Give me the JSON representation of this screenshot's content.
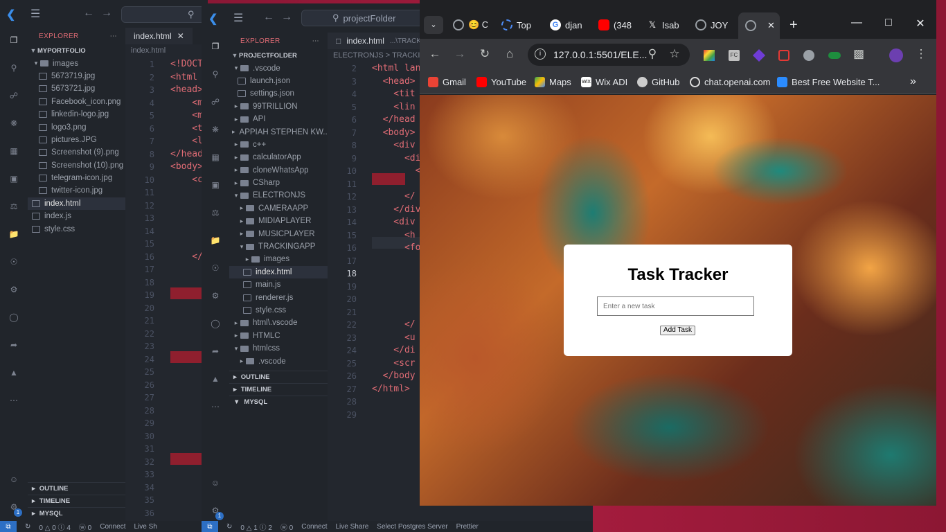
{
  "vscode_back": {
    "explorer_title": "EXPLORER",
    "folder_name": "MYPORTFOLIO",
    "items": [
      {
        "label": "images",
        "type": "folder-open"
      },
      {
        "label": "5673719.jpg",
        "type": "file"
      },
      {
        "label": "5673721.jpg",
        "type": "file"
      },
      {
        "label": "Facebook_icon.png",
        "type": "file"
      },
      {
        "label": "linkedin-logo.jpg",
        "type": "file"
      },
      {
        "label": "logo3.png",
        "type": "file"
      },
      {
        "label": "pictures.JPG",
        "type": "file"
      },
      {
        "label": "Screenshot (9).png",
        "type": "file"
      },
      {
        "label": "Screenshot (10).png",
        "type": "file"
      },
      {
        "label": "telegram-icon.jpg",
        "type": "file"
      },
      {
        "label": "twitter-icon.jpg",
        "type": "file"
      },
      {
        "label": "index.html",
        "type": "file",
        "selected": true
      },
      {
        "label": "index.js",
        "type": "file"
      },
      {
        "label": "style.css",
        "type": "file"
      }
    ],
    "sections": [
      "OUTLINE",
      "TIMELINE",
      "MYSQL"
    ],
    "tab_label": "index.html",
    "breadcrumb": "index.html",
    "line_numbers": [
      "1",
      "2",
      "3",
      "4",
      "5",
      "6",
      "7",
      "8",
      "9",
      "10",
      "11",
      "12",
      "13",
      "14",
      "15",
      "16",
      "17",
      "18",
      "19",
      "20",
      "21",
      "22",
      "23",
      "24",
      "25",
      "26",
      "27",
      "28",
      "29",
      "30",
      "31",
      "32",
      "33",
      "34",
      "35",
      "36"
    ],
    "code_lines": [
      "<!DOCT",
      "<html",
      "<head>",
      "    <m",
      "    <m",
      "    <t",
      "    <l",
      "</head",
      "<body>",
      "    <c",
      "",
      "",
      "",
      "",
      "",
      "    </",
      "",
      "",
      "",
      "",
      "",
      "",
      "",
      "",
      "",
      "",
      "",
      "",
      "",
      "",
      "",
      "",
      "",
      "",
      "",
      ""
    ],
    "status_items": [
      "0 △ 0 ⓘ 4",
      "ⓦ 0",
      "Connect",
      "Live Sh"
    ],
    "badge": "1"
  },
  "vscode_front": {
    "search_text": "projectFolder",
    "explorer_title": "EXPLORER",
    "folder_name": "PROJECTFOLDER",
    "items": [
      {
        "label": ".vscode",
        "type": "folder-open",
        "depth": 1
      },
      {
        "label": "launch.json",
        "type": "file",
        "depth": 2
      },
      {
        "label": "settings.json",
        "type": "file",
        "depth": 2
      },
      {
        "label": "99TRILLION",
        "type": "folder",
        "depth": 1
      },
      {
        "label": "API",
        "type": "folder",
        "depth": 1
      },
      {
        "label": "APPIAH STEPHEN KW...",
        "type": "folder",
        "depth": 1
      },
      {
        "label": "c++",
        "type": "folder",
        "depth": 1
      },
      {
        "label": "calculatorApp",
        "type": "folder",
        "depth": 1
      },
      {
        "label": "cloneWhatsApp",
        "type": "folder",
        "depth": 1
      },
      {
        "label": "CSharp",
        "type": "folder",
        "depth": 1
      },
      {
        "label": "ELECTRONJS",
        "type": "folder-open",
        "depth": 1
      },
      {
        "label": "CAMERAAPP",
        "type": "folder",
        "depth": 2
      },
      {
        "label": "MIDIAPLAYER",
        "type": "folder",
        "depth": 2
      },
      {
        "label": "MUSICPLAYER",
        "type": "folder",
        "depth": 2
      },
      {
        "label": "TRACKINGAPP",
        "type": "folder-open",
        "depth": 2
      },
      {
        "label": "images",
        "type": "folder",
        "depth": 3
      },
      {
        "label": "index.html",
        "type": "file",
        "depth": 3,
        "selected": true
      },
      {
        "label": "main.js",
        "type": "file",
        "depth": 3
      },
      {
        "label": "renderer.js",
        "type": "file",
        "depth": 3
      },
      {
        "label": "style.css",
        "type": "file",
        "depth": 3
      },
      {
        "label": "html\\.vscode",
        "type": "folder",
        "depth": 1
      },
      {
        "label": "HTMLC",
        "type": "folder",
        "depth": 1
      },
      {
        "label": "htmlcss",
        "type": "folder-open",
        "depth": 1
      },
      {
        "label": ".vscode",
        "type": "folder",
        "depth": 2
      }
    ],
    "sections": [
      "OUTLINE",
      "TIMELINE",
      "MYSQL"
    ],
    "tab_label": "index.html",
    "tab_path": "...\\TRACKING",
    "breadcrumb": "ELECTRONJS > TRACKING",
    "line_numbers": [
      "2",
      "3",
      "4",
      "5",
      "6",
      "7",
      "8",
      "9",
      "10",
      "11",
      "12",
      "13",
      "14",
      "15",
      "16",
      "17",
      "18",
      "19",
      "20",
      "21",
      "22",
      "23",
      "24",
      "25",
      "26",
      "27",
      "28",
      "29"
    ],
    "active_line": "18",
    "code_lines": [
      "<html lan",
      "  <head>",
      "    <tit",
      "    <lin",
      "  </head",
      "  <body>",
      "    <div",
      "      <di",
      "        <",
      "",
      "      </",
      "    </div",
      "    <div",
      "      <h",
      "      <fo",
      "",
      "",
      "",
      "",
      "",
      "      </",
      "      <u",
      "    </di",
      "    <scr",
      "  </body",
      "</html>",
      "",
      ""
    ],
    "status_items": [
      "0 △ 1 ⓘ 2",
      "ⓦ 0",
      "Connect",
      "Live Share",
      "Select Postgres Server",
      "Prettier"
    ],
    "badge": "1"
  },
  "browser": {
    "tabs": [
      {
        "label": "😊 C",
        "icon": "globe-icon"
      },
      {
        "label": "Top",
        "icon": "loading-icon"
      },
      {
        "label": "djan",
        "icon": "google-icon"
      },
      {
        "label": "(348",
        "icon": "youtube-icon"
      },
      {
        "label": "Isab",
        "icon": "x-icon"
      },
      {
        "label": "JOY",
        "icon": "globe-icon"
      }
    ],
    "url": "127.0.0.1:5501/ELE...",
    "bookmarks": [
      {
        "label": "Gmail",
        "color": "#ea4335"
      },
      {
        "label": "YouTube",
        "color": "#ff0000"
      },
      {
        "label": "Maps",
        "color": "#34a853"
      },
      {
        "label": "Wix ADI",
        "color": "#ffffff"
      },
      {
        "label": "GitHub",
        "color": "#cccccc"
      },
      {
        "label": "chat.openai.com",
        "color": "#dddddd"
      },
      {
        "label": "Best Free Website T...",
        "color": "#2b8cff"
      }
    ],
    "more_bookmarks": "»"
  },
  "app": {
    "title": "Task Tracker",
    "input_placeholder": "Enter a new task",
    "button_label": "Add Task"
  }
}
